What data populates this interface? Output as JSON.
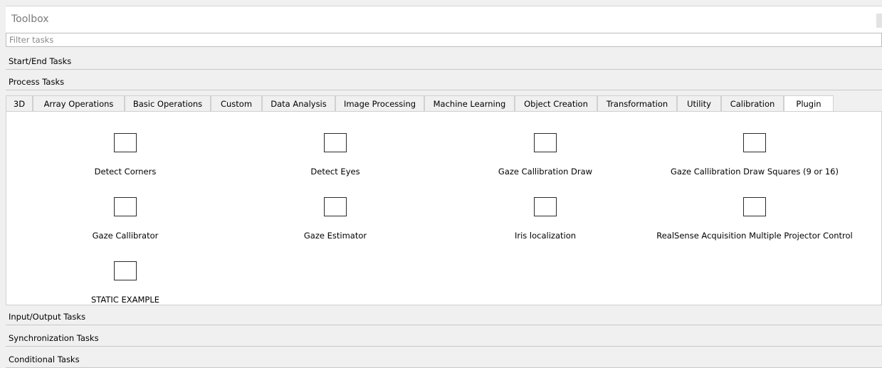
{
  "toolbox": {
    "title": "Toolbox"
  },
  "filter": {
    "placeholder": "Filter tasks",
    "value": ""
  },
  "sections": {
    "start_end": "Start/End Tasks",
    "process": "Process Tasks",
    "input_output": "Input/Output Tasks",
    "synchronization": "Synchronization Tasks",
    "conditional": "Conditional Tasks"
  },
  "tabs": [
    "3D",
    "Array Operations",
    "Basic Operations",
    "Custom",
    "Data Analysis",
    "Image Processing",
    "Machine Learning",
    "Object Creation",
    "Transformation",
    "Utility",
    "Calibration",
    "Plugin"
  ],
  "active_tab": "Plugin",
  "plugin_tasks": [
    "Detect Corners",
    "Detect Eyes",
    "Gaze Callibration Draw",
    "Gaze Callibration Draw Squares (9 or 16)",
    "Gaze Callibrator",
    "Gaze Estimator",
    "Iris localization",
    "RealSense Acquisition Multiple Projector Control",
    "STATIC EXAMPLE"
  ]
}
